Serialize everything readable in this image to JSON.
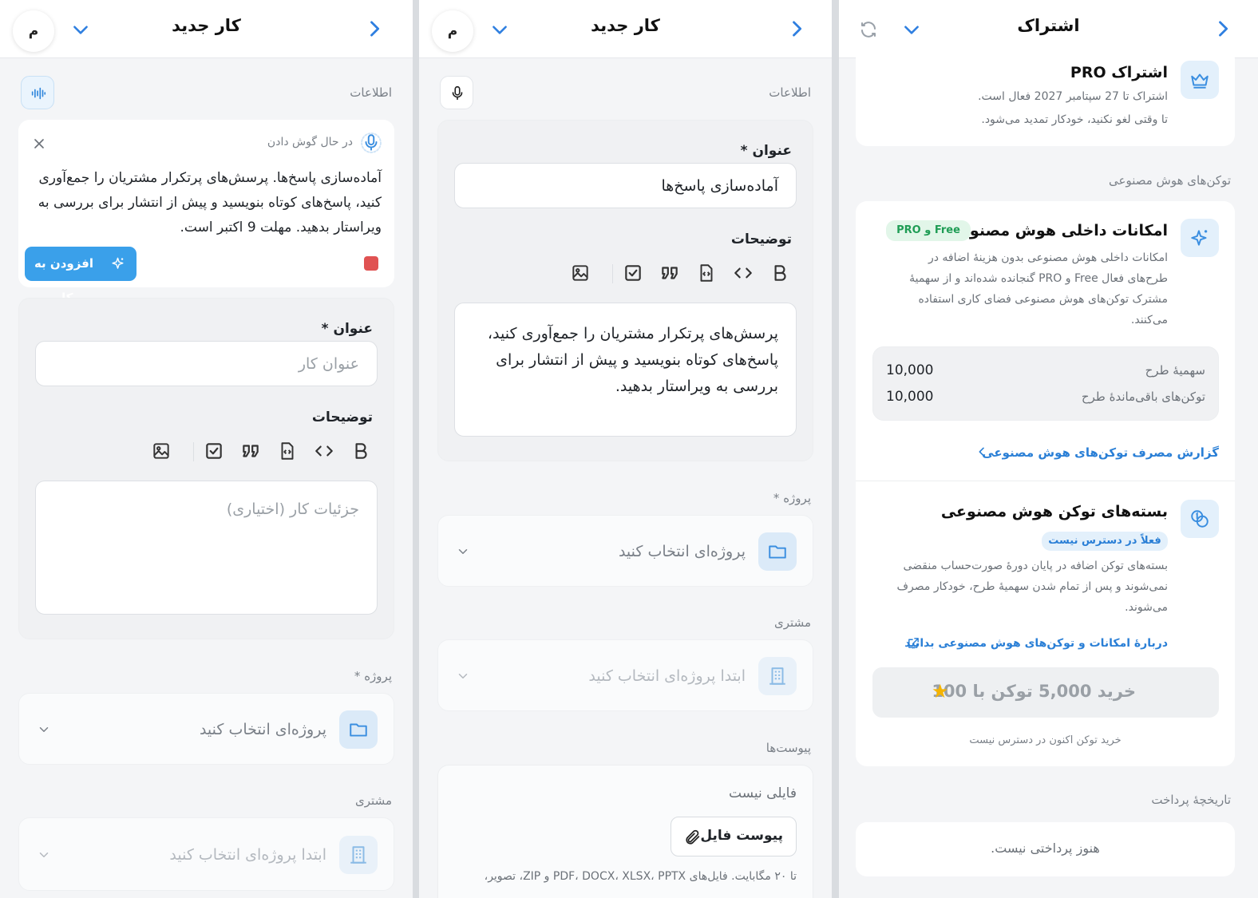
{
  "panel1": {
    "header": {
      "title": "کار جدید",
      "avatar": "م"
    },
    "info_label": "اطلاعات",
    "listening": {
      "status": "در حال گوش دادن",
      "transcript": "آماده‌سازی پاسخ‌ها. پرسش‌های پرتکرار مشتریان را جمع‌آوری کنید، پاسخ‌های کوتاه بنویسید و پیش از انتشار برای بررسی به ویراستار بدهید. مهلت 9 اکتبر است.",
      "add_button": "افزودن به کار"
    },
    "title_label": "عنوان *",
    "title_placeholder": "عنوان کار",
    "desc_label": "توضیحات",
    "desc_placeholder": "جزئیات کار (اختیاری)",
    "project_label": "پروژه *",
    "project_placeholder": "پروژه‌ای انتخاب کنید",
    "customer_label": "مشتری",
    "customer_placeholder": "ابتدا پروژه‌ای انتخاب کنید"
  },
  "panel2": {
    "header": {
      "title": "کار جدید",
      "avatar": "م"
    },
    "info_label": "اطلاعات",
    "title_label": "عنوان *",
    "title_value": "آماده‌سازی پاسخ‌ها",
    "desc_label": "توضیحات",
    "desc_value": "پرسش‌های پرتکرار مشتریان را جمع‌آوری کنید، پاسخ‌های کوتاه بنویسید و پیش از انتشار برای بررسی به ویراستار بدهید.",
    "project_label": "پروژه *",
    "project_placeholder": "پروژه‌ای انتخاب کنید",
    "customer_label": "مشتری",
    "customer_placeholder": "ابتدا پروژه‌ای انتخاب کنید",
    "attachments_label": "پیوست‌ها",
    "no_file": "فایلی نیست",
    "attach_button": "پیوست فایل",
    "attach_hint": "تا ۲۰ مگابایت. فایل‌های PDF، DOCX، XLSX، PPTX و ZIP، تصویر،"
  },
  "panel3": {
    "header": {
      "title": "اشتراک"
    },
    "pro": {
      "title": "اشتراک PRO",
      "line1": "اشتراک تا 27 سپتامبر 2027 فعال است.",
      "line2": "تا وقتی لغو نکنید، خودکار تمدید می‌شود."
    },
    "ai_tokens_label": "توکن‌های هوش مصنوعی",
    "ai_builtin": {
      "title": "امکانات داخلی هوش مصنوعی",
      "badge": "Free و PRO",
      "lines": [
        "امکانات داخلی هوش مصنوعی بدون هزینهٔ اضافه در",
        "طرح‌های فعال Free و PRO گنجانده شده‌اند و از سهمیهٔ",
        "مشترک توکن‌های هوش مصنوعی فضای کاری استفاده",
        "می‌کنند."
      ],
      "rows": [
        {
          "label": "سهمیهٔ طرح",
          "value": "10,000"
        },
        {
          "label": "توکن‌های باقی‌ماندهٔ طرح",
          "value": "10,000"
        }
      ],
      "report_link": "گزارش مصرف توکن‌های هوش مصنوعی"
    },
    "packs": {
      "title": "بسته‌های توکن هوش مصنوعی",
      "badge": "فعلاً در دسترس نیست",
      "lines": [
        "بسته‌های توکن اضافه در پایان دورهٔ صورت‌حساب منقضی",
        "نمی‌شوند و پس از تمام شدن سهمیهٔ طرح، خودکار مصرف",
        "می‌شوند."
      ],
      "learn_link": "دربارهٔ امکانات و توکن‌های هوش مصنوعی بدانید",
      "buy_button": "خرید 5,000 توکن با 100",
      "buy_note": "خرید توکن اکنون در دسترس نیست"
    },
    "payments_label": "تاریخچهٔ پرداخت",
    "no_payments": "هنوز پرداختی نیست."
  },
  "colors": {
    "accent": "#2f7fe0",
    "button": "#3aa0ea",
    "green_badge": "#1f9d55",
    "record": "#e05252"
  }
}
